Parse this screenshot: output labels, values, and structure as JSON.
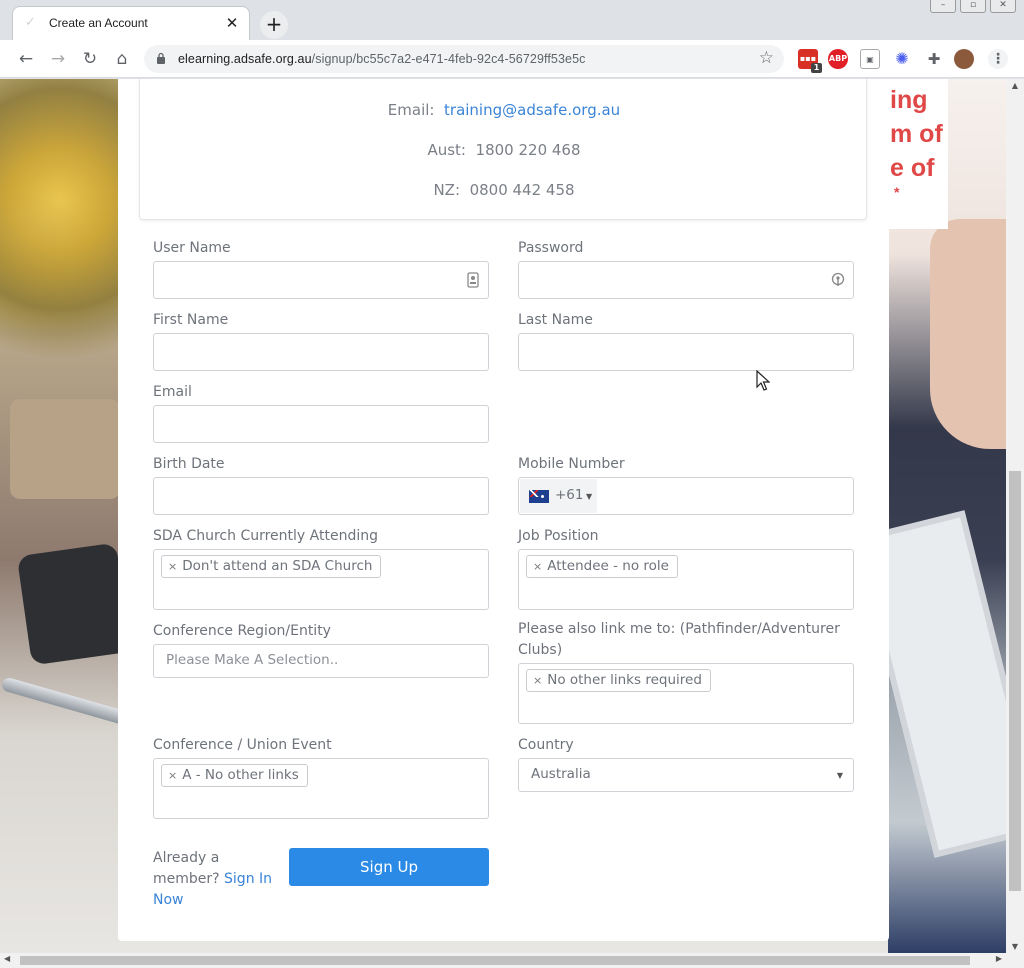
{
  "browser": {
    "tab_title": "Create an Account",
    "tab_close": "✕",
    "new_tab": "+",
    "url_host": "elearning.adsafe.org.au",
    "url_path": "/signup/bc55c7a2-e471-4feb-92c4-56729ff53e5c",
    "ext_badge_count": "1",
    "ext_abp": "ABP"
  },
  "contact": {
    "email_label": "Email:",
    "email_value": "training@adsafe.org.au",
    "aust_label": "Aust:",
    "aust_value": "1800 220 468",
    "nz_label": "NZ:",
    "nz_value": "0800 442 458"
  },
  "background": {
    "overlay_text_lines": [
      "ing",
      "m of",
      "e of",
      "*"
    ]
  },
  "form": {
    "username_label": "User Name",
    "password_label": "Password",
    "firstname_label": "First Name",
    "lastname_label": "Last Name",
    "email_label": "Email",
    "birthdate_label": "Birth Date",
    "mobile_label": "Mobile Number",
    "mobile_code": "+61",
    "church_label": "SDA Church Currently Attending",
    "church_selected": "Don't attend an SDA Church",
    "job_label": "Job Position",
    "job_selected": "Attendee - no role",
    "conference_label": "Conference Region/Entity",
    "conference_placeholder": "Please Make A Selection..",
    "link_label_line1": "Please also link me to: (Pathfinder/Adventurer",
    "link_label_line2": "Clubs)",
    "link_selected": "No other links required",
    "event_label": "Conference / Union Event",
    "event_selected": "A - No other links",
    "country_label": "Country",
    "country_value": "Australia",
    "chip_remove": "×",
    "already_text": "Already a member?",
    "signin_link": "Sign In Now",
    "signup_button": "Sign Up"
  },
  "colors": {
    "accent": "#2a8ae6",
    "link": "#3a84d8",
    "label_text": "#6e737b"
  }
}
